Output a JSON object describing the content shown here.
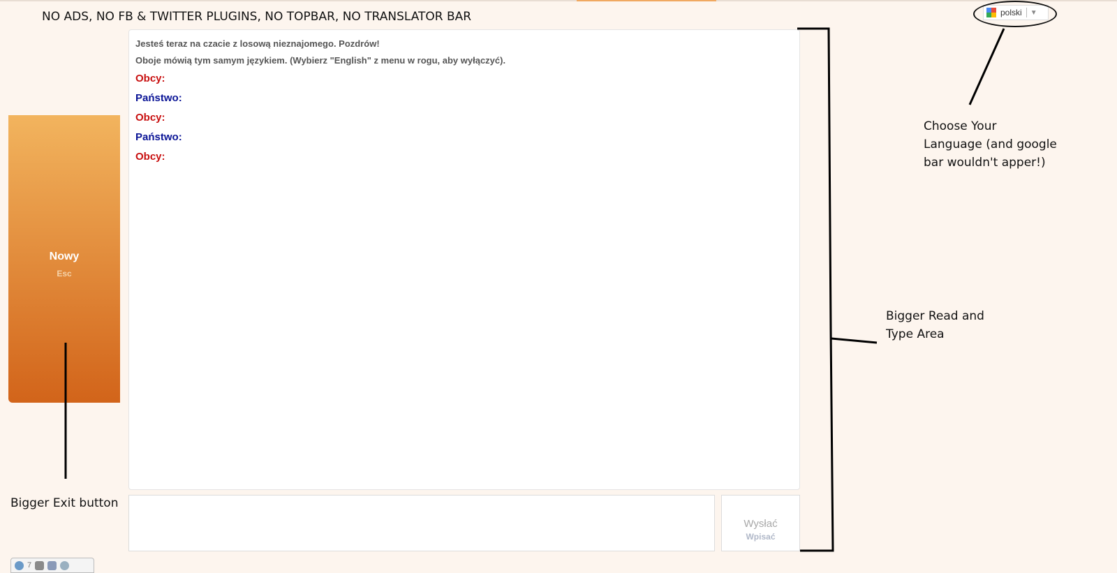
{
  "headline": "NO ADS, NO FB & TWITTER PLUGINS, NO TOPBAR, NO TRANSLATOR BAR",
  "language_widget": {
    "selected": "polski",
    "arrow": "▼"
  },
  "annotations": {
    "language": "Choose Your\nLanguage (and google\nbar wouldn't apper!)",
    "area": "Bigger Read and\nType Area",
    "exit": "Bigger Exit button"
  },
  "exit_button": {
    "label": "Nowy",
    "shortcut": "Esc"
  },
  "chat": {
    "system_messages": [
      "Jesteś teraz na czacie z losową nieznajomego. Pozdrów!",
      "Oboje mówią tym samym językiem. (Wybierz \"English\" z menu w rogu, aby wyłączyć)."
    ],
    "lines": [
      {
        "speaker": "Obcy",
        "role": "stranger"
      },
      {
        "speaker": "Państwo",
        "role": "you"
      },
      {
        "speaker": "Obcy",
        "role": "stranger"
      },
      {
        "speaker": "Państwo",
        "role": "you"
      },
      {
        "speaker": "Obcy",
        "role": "stranger"
      }
    ]
  },
  "message_input": {
    "value": "",
    "placeholder": ""
  },
  "send_button": {
    "label": "Wysłać",
    "shortcut": "Wpisać"
  },
  "bottom_toolbar": {
    "count": "7"
  },
  "colors": {
    "stranger": "#c81010",
    "you": "#0a1496",
    "exit_top": "#f2b45e",
    "exit_bottom": "#d2641a"
  }
}
